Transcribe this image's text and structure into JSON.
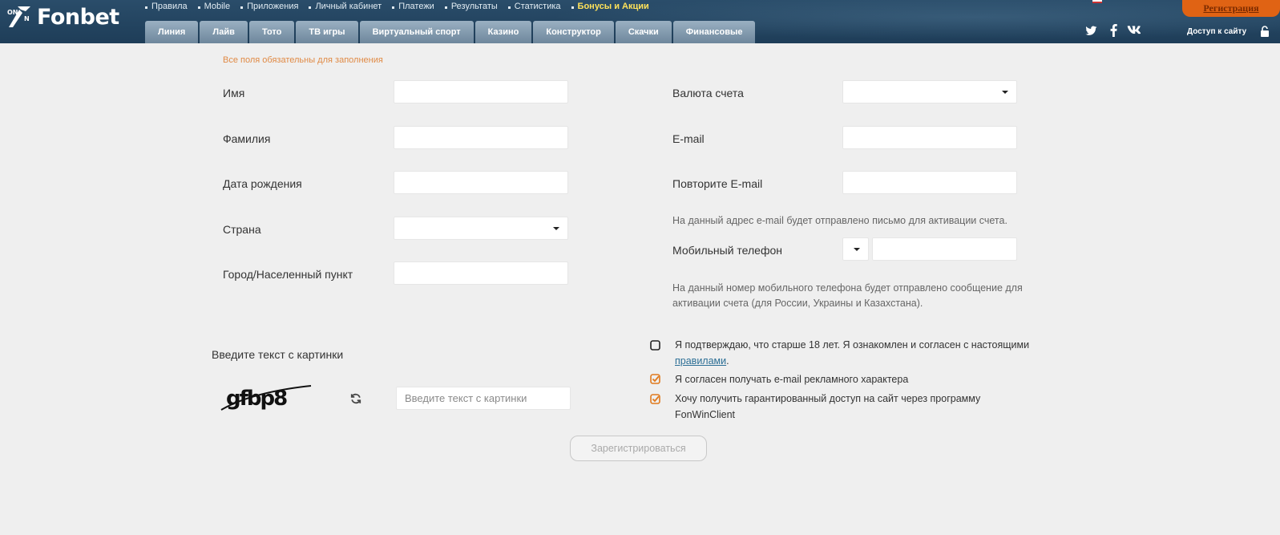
{
  "header": {
    "logo_text": "Fonbet",
    "top_links": [
      {
        "label": "Правила"
      },
      {
        "label": "Mobile"
      },
      {
        "label": "Приложения"
      },
      {
        "label": "Личный кабинет"
      },
      {
        "label": "Платежи"
      },
      {
        "label": "Результаты"
      },
      {
        "label": "Статистика"
      },
      {
        "label": "Бонусы и Акции"
      }
    ],
    "tabs": [
      {
        "label": "Линия"
      },
      {
        "label": "Лайв"
      },
      {
        "label": "Тото"
      },
      {
        "label": "ТВ игры"
      },
      {
        "label": "Виртуальный спорт"
      },
      {
        "label": "Казино"
      },
      {
        "label": "Конструктор"
      },
      {
        "label": "Скачки"
      },
      {
        "label": "Финансовые"
      }
    ],
    "register_label": "Регистрация",
    "social": [
      "twitter-icon",
      "facebook-icon",
      "vk-icon"
    ],
    "site_access_label": "Доступ к сайту",
    "colors": {
      "header_bg": "#1e3d58",
      "register_bg": "#e06314",
      "bonus_link": "#ffe25a"
    }
  },
  "form": {
    "required_note": "Все поля обязательны для заполнения",
    "left_fields": [
      {
        "label": "Имя",
        "value": ""
      },
      {
        "label": "Фамилия",
        "value": ""
      },
      {
        "label": "Дата рождения",
        "value": ""
      },
      {
        "label": "Страна",
        "value": "",
        "type": "select"
      },
      {
        "label": "Город/Населенный пункт",
        "value": ""
      }
    ],
    "right_fields": [
      {
        "label": "Валюта счета",
        "value": "",
        "type": "select"
      },
      {
        "label": "E-mail",
        "value": ""
      },
      {
        "label": "Повторите E-mail",
        "value": ""
      }
    ],
    "email_hint": "На данный адрес e-mail будет отправлено письмо для активации счета.",
    "phone": {
      "label": "Мобильный телефон",
      "code_value": "",
      "number_value": ""
    },
    "phone_hint_line1": "На данный номер мобильного телефона будет отправлено сообщение для",
    "phone_hint_line2": "активации счета (для России, Украины и Казахстана).",
    "captcha": {
      "label": "Введите текст с картинки",
      "image_text": "gfbp8",
      "placeholder": "Введите текст с картинки",
      "value": ""
    },
    "checkboxes": [
      {
        "line1": "Я подтверждаю, что старше 18 лет. Я ознакомлен и согласен с настоящими",
        "link": "правилами",
        "suffix": ".",
        "checked": false
      },
      {
        "line1": "Я согласен получать e-mail рекламного характера",
        "checked": true
      },
      {
        "line1": "Хочу получить гарантированный доступ на сайт через программу",
        "line2": "FonWinClient",
        "checked": true
      }
    ],
    "submit_label": "Зарегистрироваться"
  }
}
